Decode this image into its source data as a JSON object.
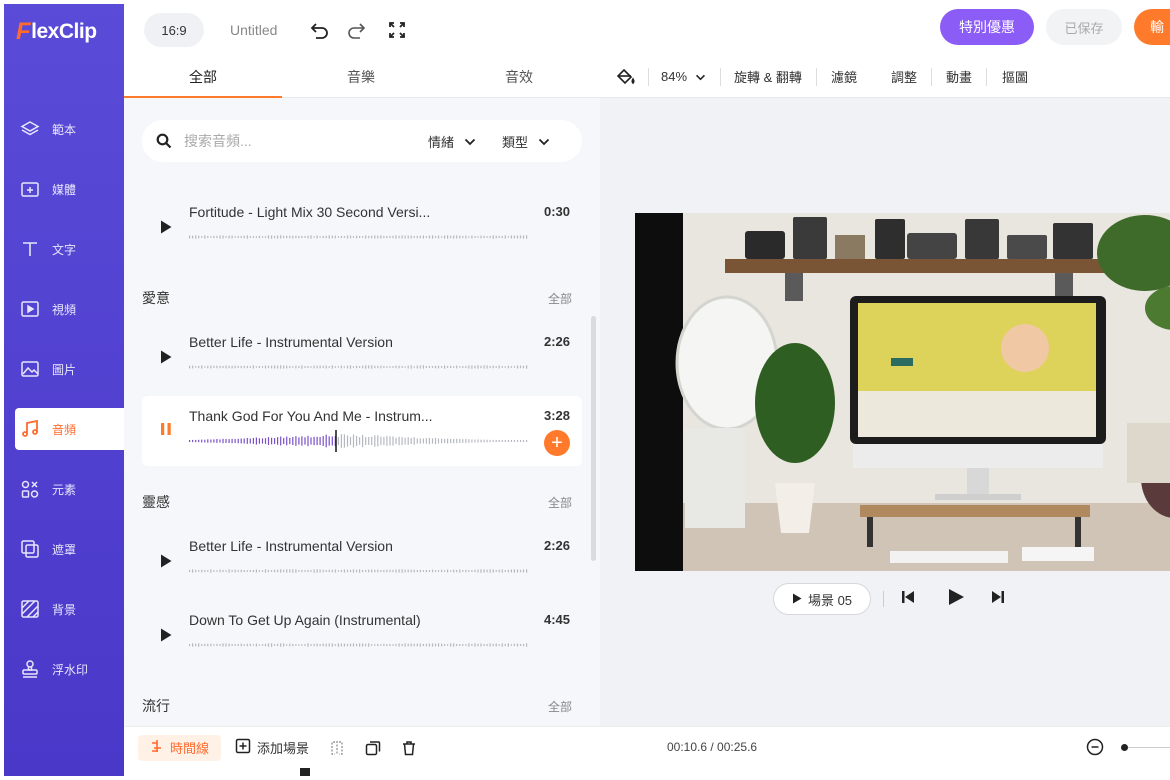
{
  "app": {
    "logo_f": "F",
    "logo_rest": "lexClip"
  },
  "topbar": {
    "ratio": "16:9",
    "title": "Untitled",
    "promo": "特別優惠",
    "saved": "已保存",
    "export": "輸"
  },
  "sidebar": {
    "items": [
      {
        "label": "範本",
        "icon": "layers-icon"
      },
      {
        "label": "媒體",
        "icon": "folder-plus-icon"
      },
      {
        "label": "文字",
        "icon": "text-icon"
      },
      {
        "label": "視頻",
        "icon": "video-icon"
      },
      {
        "label": "圖片",
        "icon": "image-icon"
      },
      {
        "label": "音頻",
        "icon": "music-icon"
      },
      {
        "label": "元素",
        "icon": "shapes-icon"
      },
      {
        "label": "遮罩",
        "icon": "mask-icon"
      },
      {
        "label": "背景",
        "icon": "background-icon"
      },
      {
        "label": "浮水印",
        "icon": "stamp-icon"
      }
    ]
  },
  "panel": {
    "tabs": [
      {
        "label": "全部"
      },
      {
        "label": "音樂"
      },
      {
        "label": "音效"
      }
    ],
    "search": {
      "placeholder": "搜索音頻..."
    },
    "filters": [
      {
        "label": "情緒"
      },
      {
        "label": "類型"
      }
    ],
    "sections": [
      {
        "title": "愛意",
        "all": "全部"
      },
      {
        "title": "靈感",
        "all": "全部"
      },
      {
        "title": "流行",
        "all": "全部"
      }
    ],
    "tracks": [
      {
        "name": "Fortitude - Light Mix 30 Second Versi...",
        "duration": "0:30"
      },
      {
        "name": "Better Life - Instrumental Version",
        "duration": "2:26"
      },
      {
        "name": "Thank God For You And Me - Instrum...",
        "duration": "3:28",
        "progress": 0.43
      },
      {
        "name": "Better Life - Instrumental Version",
        "duration": "2:26"
      },
      {
        "name": "Down To Get Up Again (Instrumental)",
        "duration": "4:45"
      }
    ]
  },
  "editor": {
    "zoom": "84%",
    "tools": [
      {
        "label": "旋轉 & 翻轉"
      },
      {
        "label": "濾鏡"
      },
      {
        "label": "調整"
      },
      {
        "label": "動畫"
      },
      {
        "label": "摳圖"
      }
    ],
    "scene_label": "場景 05"
  },
  "bottom": {
    "timeline": "時間線",
    "add_scene": "添加場景",
    "time": "00:10.6 / 00:25.6"
  },
  "colors": {
    "accent": "#ff7a2a",
    "sidebar": "#4f3fd0",
    "promo": "#8b5cf6",
    "wave_played": "#7a4fc9"
  }
}
